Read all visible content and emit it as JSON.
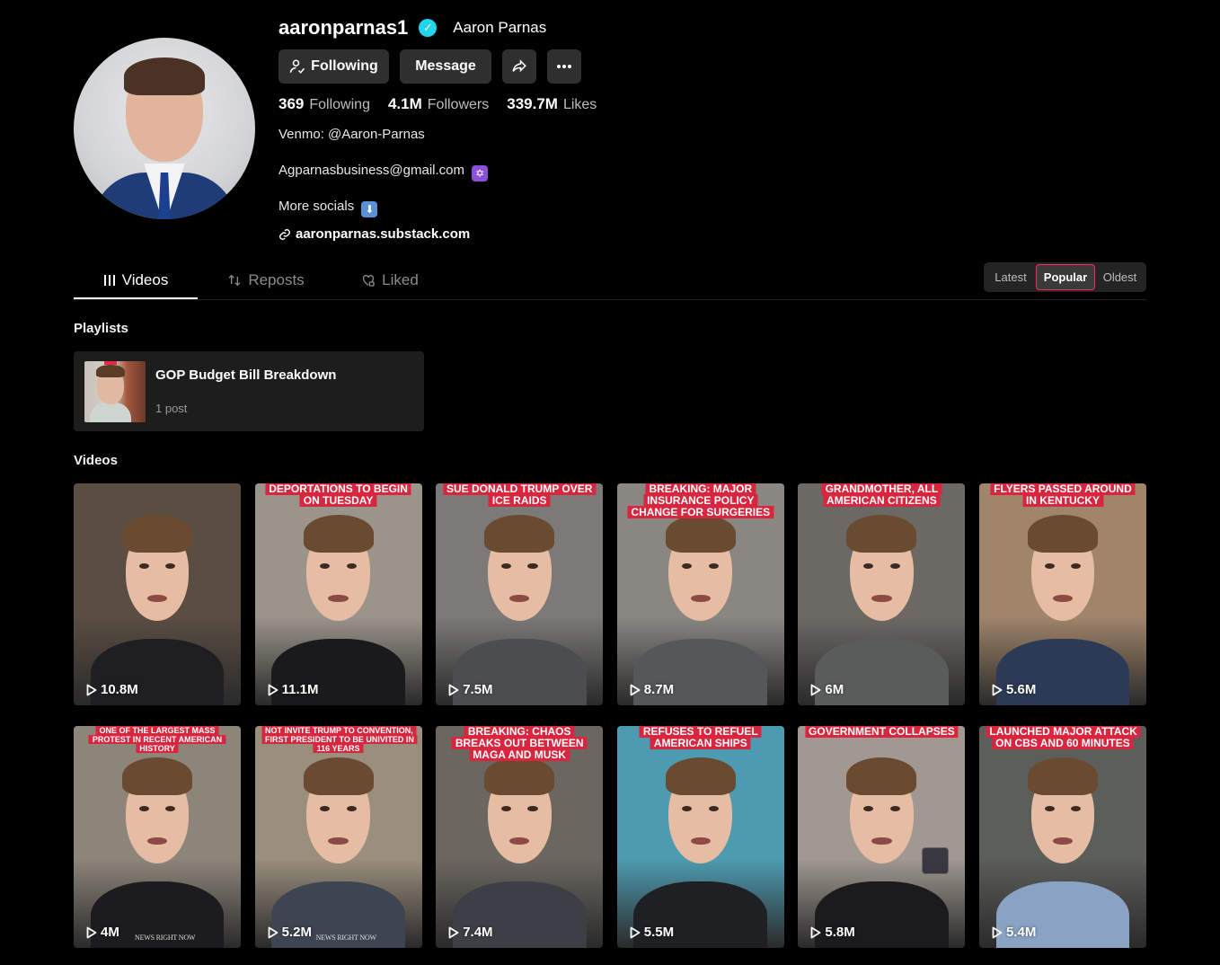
{
  "profile": {
    "username": "aaronparnas1",
    "display_name": "Aaron Parnas",
    "verified": true,
    "following_label": "Following",
    "message_label": "Message",
    "stats": {
      "following_count": "369",
      "following_label": "Following",
      "followers_count": "4.1M",
      "followers_label": "Followers",
      "likes_count": "339.7M",
      "likes_label": "Likes"
    },
    "bio": {
      "line1": "Venmo: @Aaron-Parnas",
      "line2": "Agparnasbusiness@gmail.com",
      "line3": "More socials"
    },
    "link": "aaronparnas.substack.com"
  },
  "tabs": [
    {
      "label": "Videos",
      "active": true
    },
    {
      "label": "Reposts",
      "active": false
    },
    {
      "label": "Liked",
      "active": false
    }
  ],
  "sort": {
    "options": [
      "Latest",
      "Popular",
      "Oldest"
    ],
    "selected": "Popular"
  },
  "sections": {
    "playlists": "Playlists",
    "videos": "Videos"
  },
  "playlist": {
    "title": "GOP Budget Bill Breakdown",
    "count": "1 post"
  },
  "videos": [
    {
      "caption": "",
      "views": "10.8M",
      "bg": "#5a4d42",
      "shirt": "#1f1f22"
    },
    {
      "caption": "DEPORTATIONS TO BEGIN ON TUESDAY",
      "views": "11.1M",
      "bg": "#9b948b",
      "shirt": "#1a1a1c"
    },
    {
      "caption": "SUE DONALD TRUMP OVER ICE RAIDS",
      "views": "7.5M",
      "bg": "#7b7a78",
      "shirt": "#4b4d50"
    },
    {
      "caption": "BREAKING: MAJOR INSURANCE POLICY CHANGE FOR SURGERIES",
      "views": "8.7M",
      "bg": "#8a8783",
      "shirt": "#55585a"
    },
    {
      "caption": "GRANDMOTHER, ALL AMERICAN CITIZENS",
      "views": "6M",
      "bg": "#6c6965",
      "shirt": "#5a5b5b"
    },
    {
      "caption": "FLYERS PASSED AROUND IN KENTUCKY",
      "views": "5.6M",
      "bg": "#a0856a",
      "shirt": "#2c3a55"
    },
    {
      "caption": "ONE OF THE LARGEST MASS PROTEST IN RECENT AMERICAN HISTORY",
      "views": "4M",
      "bg": "#8d857a",
      "shirt": "#1c1c1e",
      "small": true,
      "watermark": "NEWS RIGHT NOW"
    },
    {
      "caption": "NOT INVITE TRUMP TO CONVENTION, FIRST PRESIDENT TO BE UNIVITED IN 116 YEARS",
      "views": "5.2M",
      "bg": "#9a8e7d",
      "shirt": "#3d4553",
      "small": true,
      "watermark": "NEWS RIGHT NOW"
    },
    {
      "caption": "BREAKING: CHAOS BREAKS OUT BETWEEN MAGA AND MUSK",
      "views": "7.4M",
      "bg": "#6b6660",
      "shirt": "#3c3f45"
    },
    {
      "caption": "REFUSES TO REFUEL AMERICAN SHIPS",
      "views": "5.5M",
      "bg": "#4d9bb0",
      "shirt": "#1e2024"
    },
    {
      "caption": "GOVERNMENT COLLAPSES",
      "views": "5.8M",
      "bg": "#a09891",
      "shirt": "#1b1b1d"
    },
    {
      "caption": "LAUNCHED MAJOR ATTACK ON CBS AND 60 MINUTES",
      "views": "5.4M",
      "bg": "#5c5e5a",
      "shirt": "#8aa3c4"
    }
  ]
}
